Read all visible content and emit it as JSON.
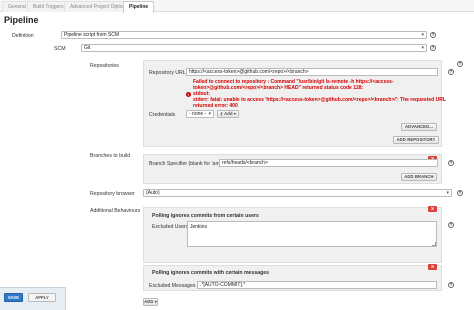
{
  "tabs": [
    {
      "label": "General"
    },
    {
      "label": "Build Triggers"
    },
    {
      "label": "Advanced Project Options"
    },
    {
      "label": "Pipeline"
    }
  ],
  "page_title": "Pipeline",
  "definition": {
    "label": "Definition",
    "value": "Pipeline script from SCM"
  },
  "scm": {
    "label": "SCM",
    "value": "Git"
  },
  "repositories": {
    "label": "Repositories",
    "url_label": "Repository URL",
    "url_value": "https://<access-token>@github.com/<repo>/<branch>",
    "error_lines": [
      "Failed to connect to repository : Command \"/usr/bin/git ls-remote -h https://<access-",
      "token>@github.com/<repo>/<branch> HEAD\" returned status code 128:",
      "stdout:",
      "stderr: fatal: unable to access 'https://<access-token>@github.com/<repo>/<branch>/': The requested URL",
      "returned error: 400"
    ],
    "credentials_label": "Credentials",
    "credentials_value": "- none -",
    "add_label": "Add",
    "advanced_label": "ADVANCED...",
    "add_repository_label": "ADD REPOSITORY"
  },
  "branches": {
    "label": "Branches to build",
    "specifier_label": "Branch Specifier (blank for 'any')",
    "specifier_value": "refs/heads/<branch>",
    "add_branch_label": "ADD BRANCH"
  },
  "browser": {
    "label": "Repository browser",
    "value": "(Auto)"
  },
  "behaviours": {
    "label": "Additional Behaviours",
    "item1_title": "Polling ignores commits from certain users",
    "excluded_users_label": "Excluded Users",
    "excluded_users_value": "Jenkins",
    "item2_title": "Polling ignores commits with certain messages",
    "excluded_messages_label": "Excluded Messages",
    "excluded_messages_value": ".*[AUTO-COMMIT].*",
    "add_label": "ADD"
  },
  "footer": {
    "save_label": "SAVE",
    "apply_label": "APPLY"
  },
  "icons": {
    "help": "?",
    "close": "X",
    "error": "!",
    "caret": "▾"
  },
  "colors": {
    "error": "#d40000",
    "save_button": "#2f79c9",
    "delete_button": "#d9413b"
  }
}
